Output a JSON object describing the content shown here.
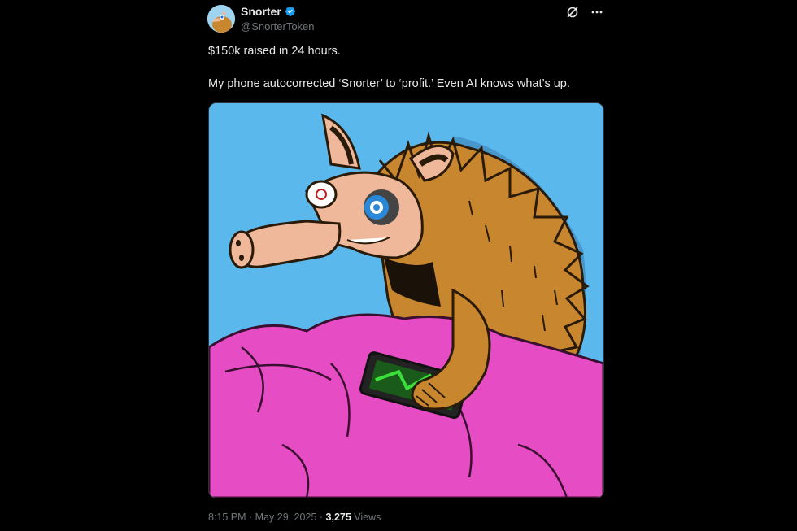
{
  "author": {
    "display_name": "Snorter",
    "handle": "@SnorterToken",
    "verified": true,
    "avatar_icon": "snorter-avatar"
  },
  "header_icons": {
    "grok": "grok-icon",
    "more": "more-icon"
  },
  "tweet": {
    "line1": "$150k raised in 24 hours.",
    "line2": "My phone autocorrected ‘Snorter’ to ‘profit.’ Even AI knows what’s up."
  },
  "media": {
    "description_icon": "snorter-aardvark-illustration"
  },
  "meta": {
    "time": "8:15 PM",
    "sep1": " · ",
    "date": "May 29, 2025",
    "sep2": " · ",
    "views_count": "3,275",
    "views_label": " Views"
  },
  "colors": {
    "background": "#000000",
    "text": "#e7e9ea",
    "muted": "#71767b",
    "verified": "#1d9bf0",
    "sky": "#5bb8ec",
    "blanket": "#e040c0",
    "fur": "#c8862e",
    "phone_glow": "#3be03b"
  }
}
